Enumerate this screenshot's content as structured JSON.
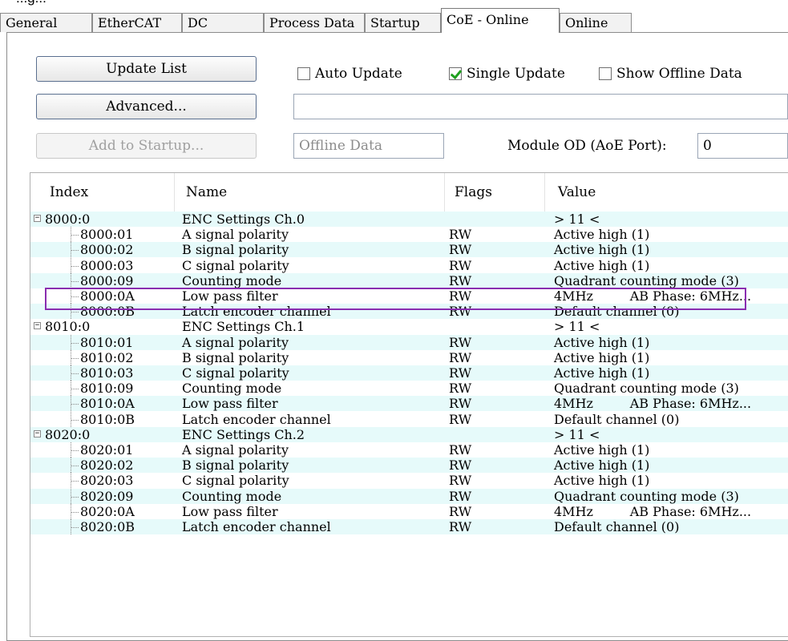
{
  "top_clip": "...g...",
  "tabs": [
    {
      "label": "General"
    },
    {
      "label": "EtherCAT"
    },
    {
      "label": "DC"
    },
    {
      "label": "Process Data"
    },
    {
      "label": "Startup"
    },
    {
      "label": "CoE - Online"
    },
    {
      "label": "Online"
    }
  ],
  "toolbar": {
    "update_list": "Update List",
    "advanced": "Advanced...",
    "add_to_startup": "Add to Startup...",
    "auto_update": "Auto Update",
    "single_update": "Single Update",
    "show_offline": "Show Offline Data",
    "offline_data": "Offline Data",
    "module_od_label": "Module OD (AoE Port):",
    "module_od_value": "0"
  },
  "columns": {
    "index": "Index",
    "name": "Name",
    "flags": "Flags",
    "value": "Value"
  },
  "rows": [
    {
      "index": "8000:0",
      "name": "ENC Settings Ch.0",
      "flags": "",
      "value": "> 11 <",
      "parent": true
    },
    {
      "index": "8000:01",
      "name": "A signal polarity",
      "flags": "RW",
      "value": "Active high (1)"
    },
    {
      "index": "8000:02",
      "name": "B signal polarity",
      "flags": "RW",
      "value": "Active high (1)"
    },
    {
      "index": "8000:03",
      "name": "C signal polarity",
      "flags": "RW",
      "value": "Active high (1)"
    },
    {
      "index": "8000:09",
      "name": "Counting mode",
      "flags": "RW",
      "value": "Quadrant counting mode (3)"
    },
    {
      "index": "8000:0A",
      "name": "Low pass filter",
      "flags": "RW",
      "value": "4MHz         AB Phase: 6MHz..."
    },
    {
      "index": "8000:0B",
      "name": "Latch encoder channel",
      "flags": "RW",
      "value": "Default channel (0)"
    },
    {
      "index": "8010:0",
      "name": "ENC Settings Ch.1",
      "flags": "",
      "value": "> 11 <",
      "parent": true
    },
    {
      "index": "8010:01",
      "name": "A signal polarity",
      "flags": "RW",
      "value": "Active high (1)"
    },
    {
      "index": "8010:02",
      "name": "B signal polarity",
      "flags": "RW",
      "value": "Active high (1)"
    },
    {
      "index": "8010:03",
      "name": "C signal polarity",
      "flags": "RW",
      "value": "Active high (1)"
    },
    {
      "index": "8010:09",
      "name": "Counting mode",
      "flags": "RW",
      "value": "Quadrant counting mode (3)"
    },
    {
      "index": "8010:0A",
      "name": "Low pass filter",
      "flags": "RW",
      "value": "4MHz         AB Phase: 6MHz..."
    },
    {
      "index": "8010:0B",
      "name": "Latch encoder channel",
      "flags": "RW",
      "value": "Default channel (0)"
    },
    {
      "index": "8020:0",
      "name": "ENC Settings Ch.2",
      "flags": "",
      "value": "> 11 <",
      "parent": true
    },
    {
      "index": "8020:01",
      "name": "A signal polarity",
      "flags": "RW",
      "value": "Active high (1)"
    },
    {
      "index": "8020:02",
      "name": "B signal polarity",
      "flags": "RW",
      "value": "Active high (1)"
    },
    {
      "index": "8020:03",
      "name": "C signal polarity",
      "flags": "RW",
      "value": "Active high (1)"
    },
    {
      "index": "8020:09",
      "name": "Counting mode",
      "flags": "RW",
      "value": "Quadrant counting mode (3)"
    },
    {
      "index": "8020:0A",
      "name": "Low pass filter",
      "flags": "RW",
      "value": "4MHz         AB Phase: 6MHz..."
    },
    {
      "index": "8020:0B",
      "name": "Latch encoder channel",
      "flags": "RW",
      "value": "Default channel (0)"
    }
  ],
  "colors": {
    "row_alt": "#e6fafa",
    "highlight": "#8a2db0",
    "check": "#1fa01f"
  },
  "icons": {
    "expand": "minus-toggle-icon",
    "single_update_check": "checkmark-icon"
  }
}
